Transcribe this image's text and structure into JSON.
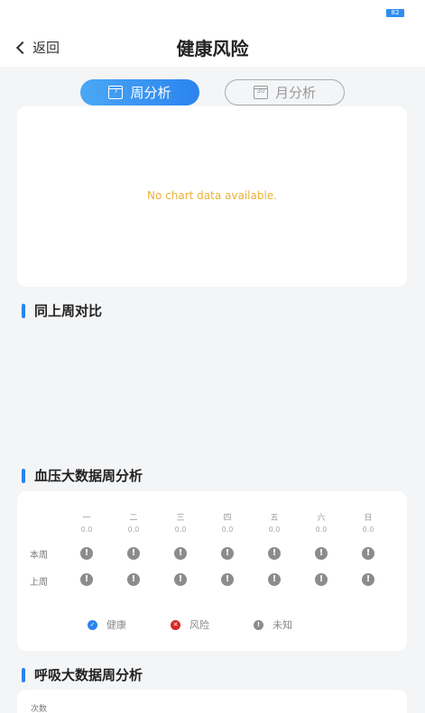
{
  "status_bar": {
    "battery": "82"
  },
  "header": {
    "back_label": "返回",
    "title": "健康风险"
  },
  "tabs": [
    {
      "label": "周分析",
      "icon": "calendar-7-icon",
      "icon_text": "7",
      "active": true
    },
    {
      "label": "月分析",
      "icon": "calendar-30-icon",
      "icon_text": "30",
      "active": false
    }
  ],
  "chart": {
    "empty_message": "No chart data available."
  },
  "sections": {
    "compare": "同上周对比",
    "blood_pressure": "血压大数据周分析",
    "respiration": "呼吸大数据周分析"
  },
  "blood_pressure": {
    "days": [
      {
        "name": "一",
        "value": "0.0"
      },
      {
        "name": "二",
        "value": "0.0"
      },
      {
        "name": "三",
        "value": "0.0"
      },
      {
        "name": "四",
        "value": "0.0"
      },
      {
        "name": "五",
        "value": "0.0"
      },
      {
        "name": "六",
        "value": "0.0"
      },
      {
        "name": "日",
        "value": "0.0"
      }
    ],
    "rows": [
      {
        "label": "本周",
        "statuses": [
          "unknown",
          "unknown",
          "unknown",
          "unknown",
          "unknown",
          "unknown",
          "unknown"
        ]
      },
      {
        "label": "上周",
        "statuses": [
          "unknown",
          "unknown",
          "unknown",
          "unknown",
          "unknown",
          "unknown",
          "unknown"
        ]
      }
    ],
    "legend": [
      {
        "label": "健康",
        "color": "#2b83ee",
        "symbol": "✓"
      },
      {
        "label": "风险",
        "color": "#d62828",
        "symbol": "✕"
      },
      {
        "label": "未知",
        "color": "#8c8c8c",
        "symbol": "!"
      }
    ]
  },
  "respiration": {
    "y_label": "次数"
  }
}
